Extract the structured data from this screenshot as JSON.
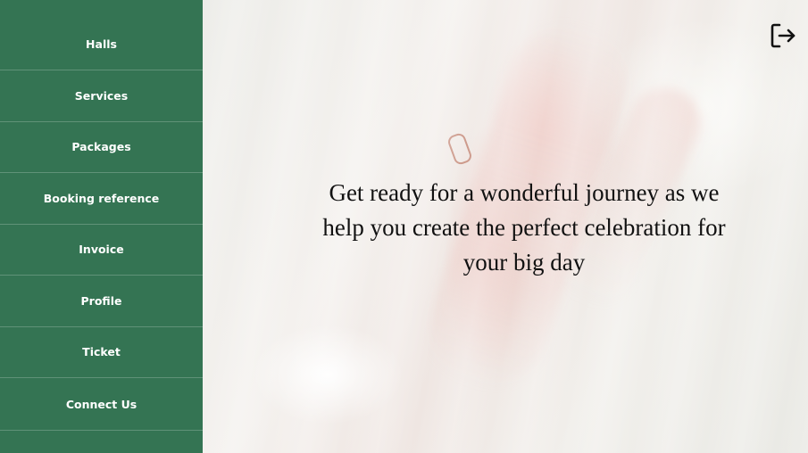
{
  "sidebar": {
    "items": [
      {
        "label": "Halls"
      },
      {
        "label": "Services"
      },
      {
        "label": "Packages"
      },
      {
        "label": "Booking reference"
      },
      {
        "label": "Invoice"
      },
      {
        "label": "Profile"
      },
      {
        "label": "Ticket"
      },
      {
        "label": "Connect Us"
      }
    ]
  },
  "main": {
    "tagline": "Get ready for a wonderful journey as we help you create the perfect celebration for your big day",
    "logout_icon": "logout-icon"
  },
  "colors": {
    "sidebar_bg": "#347453",
    "text_dark": "#111111"
  }
}
